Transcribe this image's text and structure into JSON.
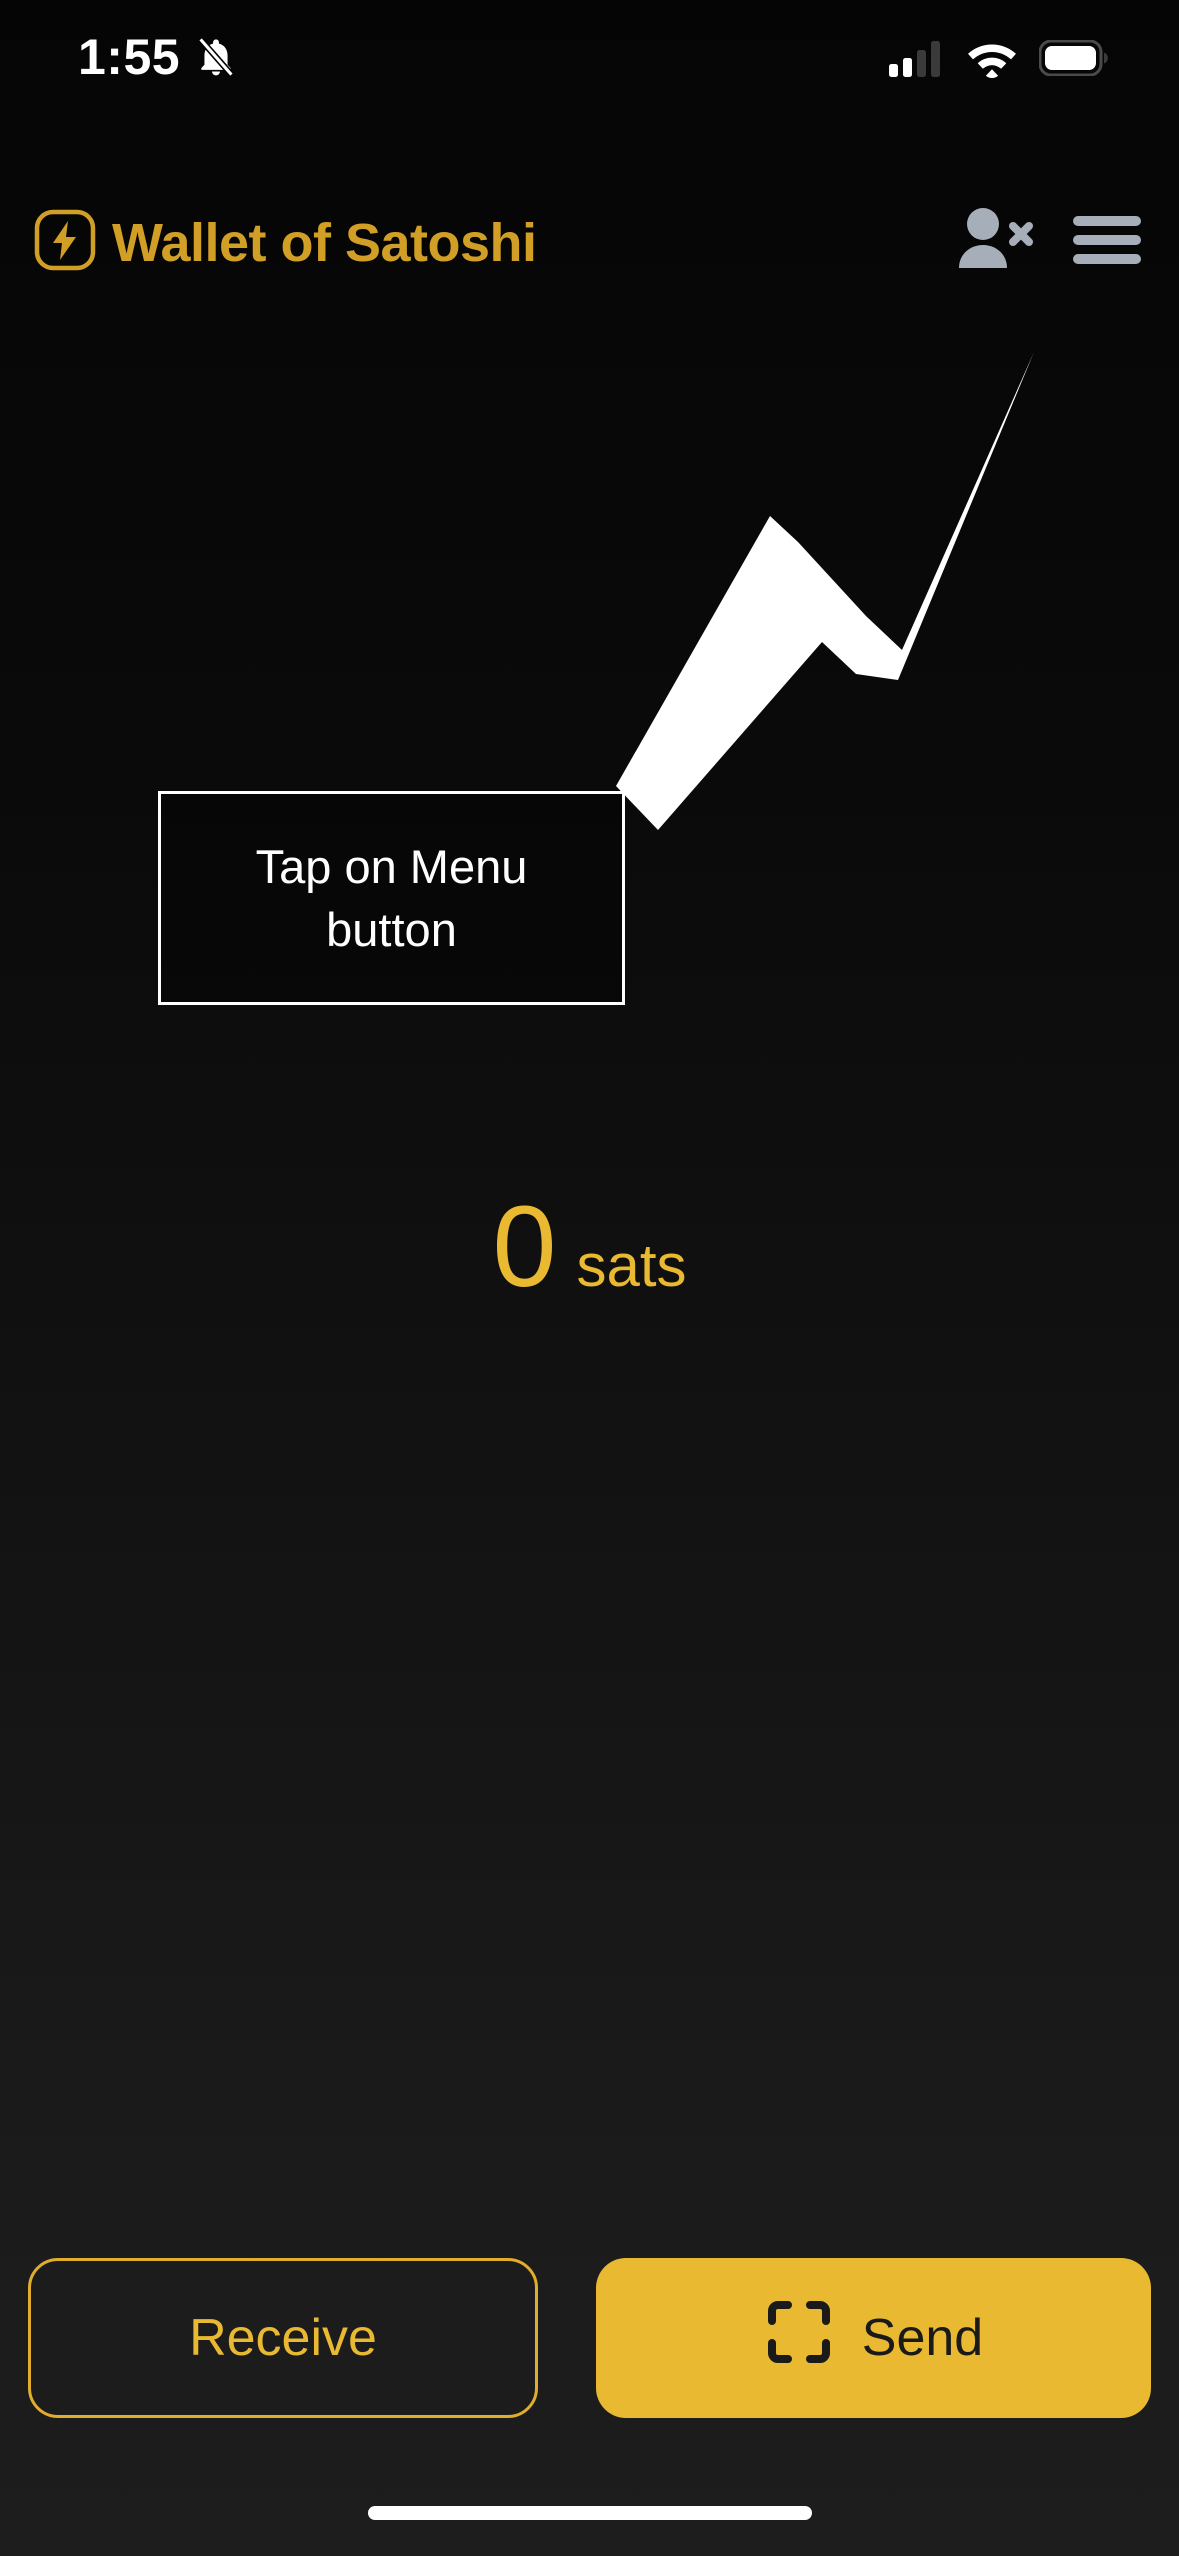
{
  "status_bar": {
    "time": "1:55",
    "silent_icon": "bell-slash-icon",
    "cellular_icon": "cellular-signal-icon",
    "wifi_icon": "wifi-icon",
    "battery_icon": "battery-icon",
    "signal_bars_filled": 2,
    "signal_bars_total": 4
  },
  "header": {
    "logo_icon": "lightning-bolt-logo-icon",
    "title": "Wallet of Satoshi",
    "brand_color": "#d19f26",
    "actions": {
      "user_remove_icon": "user-remove-icon",
      "menu_icon": "hamburger-menu-icon",
      "icon_color": "#a6aeba"
    }
  },
  "coach_mark": {
    "arrow_icon": "arrow-up-right-icon",
    "arrow_color": "#ffffff",
    "tooltip_text": "Tap on Menu button",
    "tooltip_border_color": "#ffffff",
    "tooltip_text_color": "#ffffff"
  },
  "balance": {
    "amount": "0",
    "unit": "sats",
    "color": "#e8b931"
  },
  "actions": {
    "receive_label": "Receive",
    "send_label": "Send",
    "send_icon": "qr-scan-icon",
    "accent_color": "#e8b931"
  },
  "system": {
    "home_indicator": "home-indicator"
  }
}
